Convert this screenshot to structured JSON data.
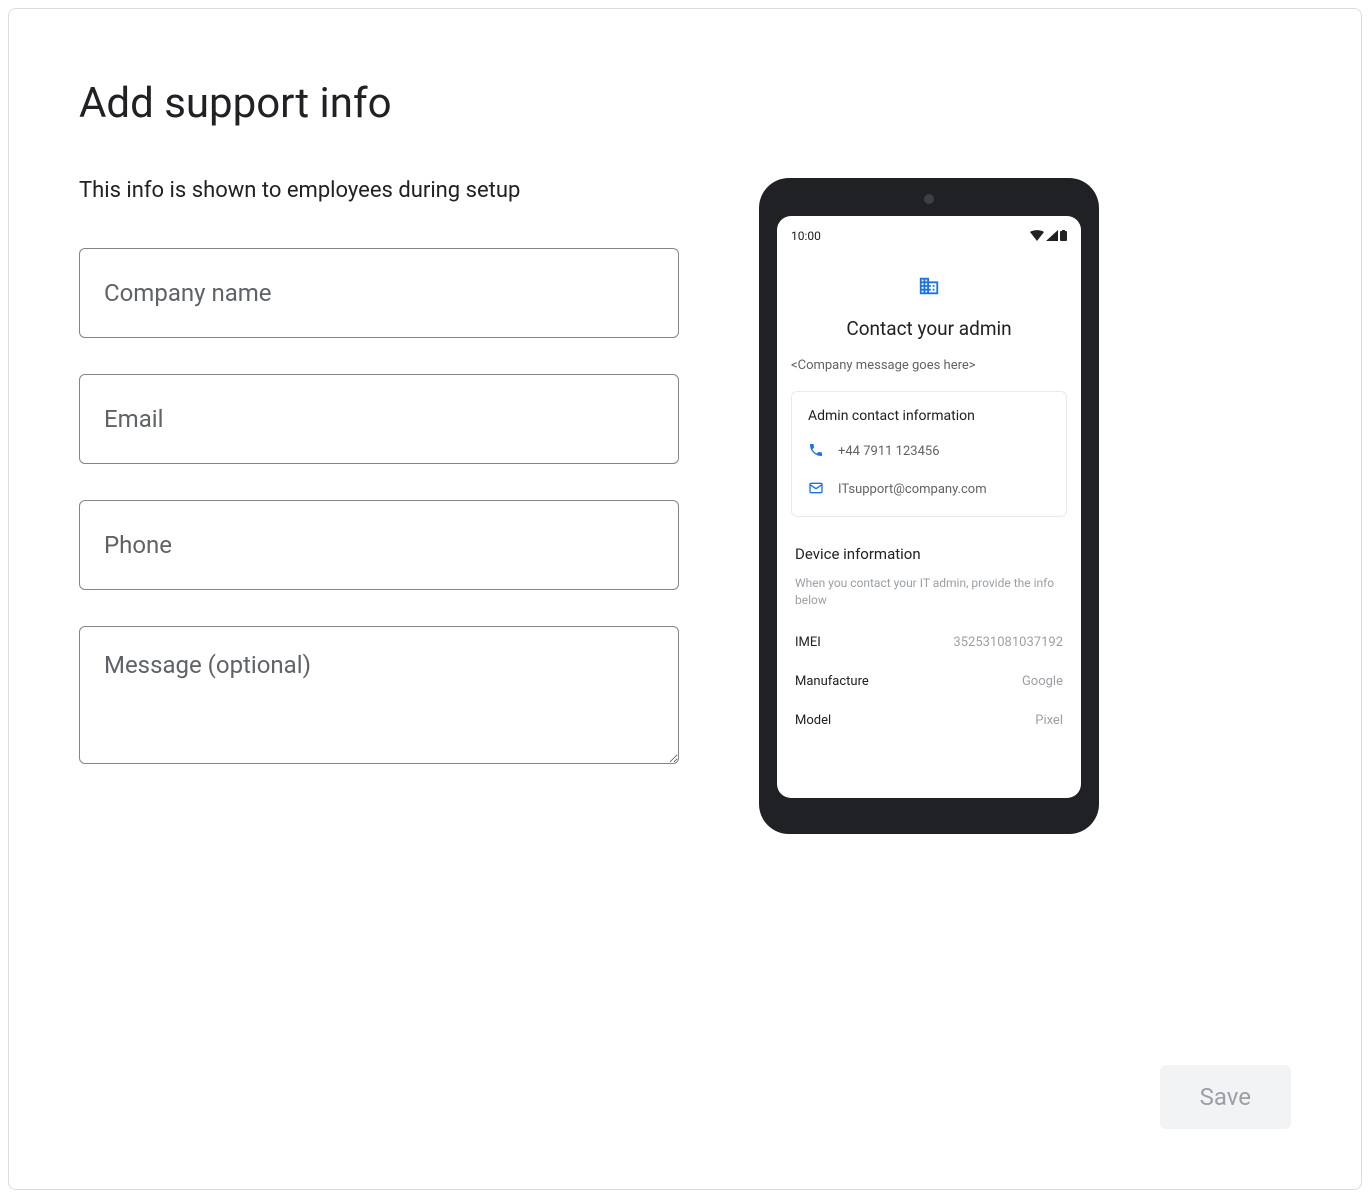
{
  "page": {
    "title": "Add support info",
    "subtitle": "This info is shown to employees during setup"
  },
  "form": {
    "company_placeholder": "Company name",
    "email_placeholder": "Email",
    "phone_placeholder": "Phone",
    "message_placeholder": "Message (optional)",
    "save_label": "Save"
  },
  "preview": {
    "status_time": "10:00",
    "heading": "Contact your admin",
    "company_message": "<Company message goes here>",
    "admin_card": {
      "title": "Admin contact information",
      "phone": "+44 7911 123456",
      "email": "ITsupport@company.com"
    },
    "device_section": {
      "title": "Device information",
      "description": "When you contact your IT admin, provide the info below",
      "rows": [
        {
          "label": "IMEI",
          "value": "352531081037192"
        },
        {
          "label": "Manufacture",
          "value": "Google"
        },
        {
          "label": "Model",
          "value": "Pixel"
        }
      ]
    }
  }
}
